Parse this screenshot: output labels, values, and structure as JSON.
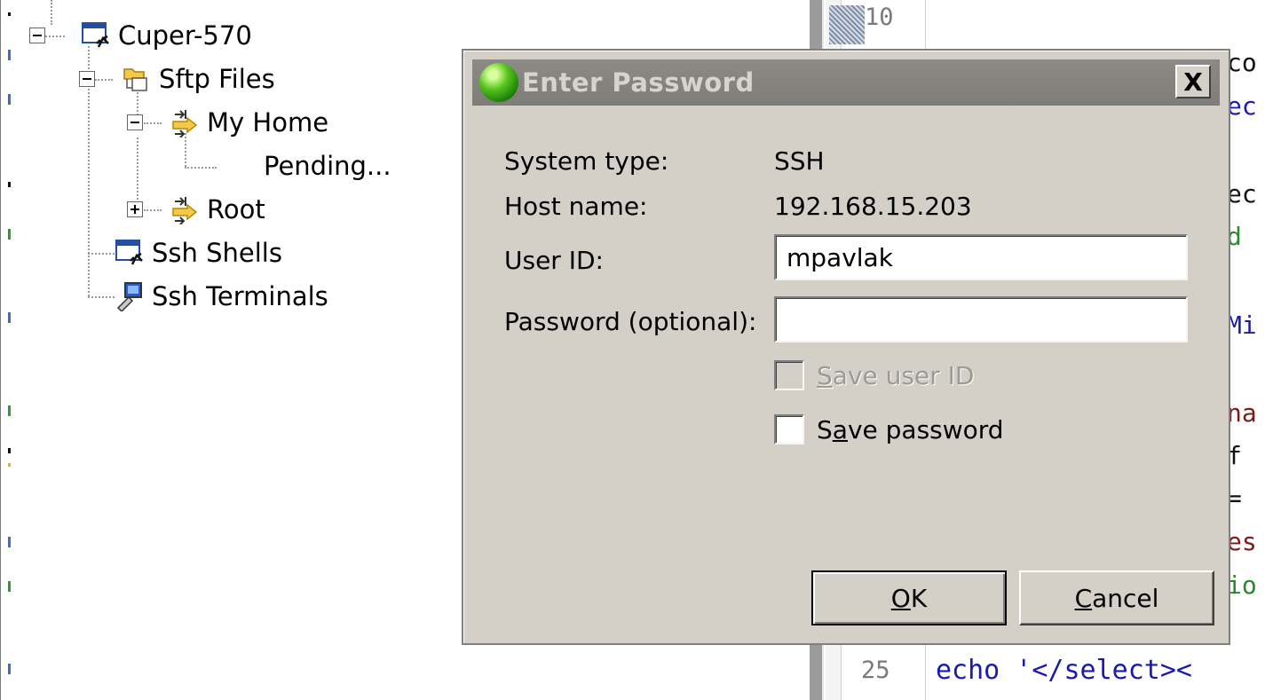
{
  "tree": {
    "items": [
      {
        "label": "Cuper-570",
        "icon": "shell-window-icon",
        "expander": "minus"
      },
      {
        "label": "Sftp Files",
        "icon": "folder-files-icon",
        "expander": "minus"
      },
      {
        "label": "My Home",
        "icon": "filter-arrow-icon",
        "expander": "minus"
      },
      {
        "label": "Pending...",
        "icon": "",
        "expander": ""
      },
      {
        "label": "Root",
        "icon": "filter-arrow-icon",
        "expander": "plus"
      },
      {
        "label": "Ssh Shells",
        "icon": "shell-window-icon",
        "expander": ""
      },
      {
        "label": "Ssh Terminals",
        "icon": "terminal-icon",
        "expander": ""
      }
    ]
  },
  "editor": {
    "line_top": "10",
    "line_bottom": "25",
    "bottom_code": "echo '</select><",
    "fragments": [
      "co",
      "ec",
      "ec",
      "d ",
      "Mi",
      "na",
      " f",
      "= ",
      "es",
      "io"
    ]
  },
  "dialog": {
    "title": "Enter Password",
    "close_label": "X",
    "system_type_label": "System type:",
    "system_type_value": "SSH",
    "host_name_label": "Host name:",
    "host_name_value": "192.168.15.203",
    "user_id_label": "User ID:",
    "user_id_value": "mpavlak",
    "password_label": "Password (optional):",
    "password_value": "",
    "save_user_id": {
      "mnemonic": "S",
      "rest": "ave user ID",
      "checked": false,
      "enabled": false
    },
    "save_password": {
      "pre": "S",
      "mnemonic": "a",
      "rest": "ve password",
      "checked": false,
      "enabled": true
    },
    "ok": {
      "mnemonic": "O",
      "rest": "K"
    },
    "cancel": {
      "mnemonic": "C",
      "rest": "ancel"
    }
  },
  "colors": {
    "dialog_bg": "#d4d0c8",
    "titlebar_inactive": "#808080"
  }
}
